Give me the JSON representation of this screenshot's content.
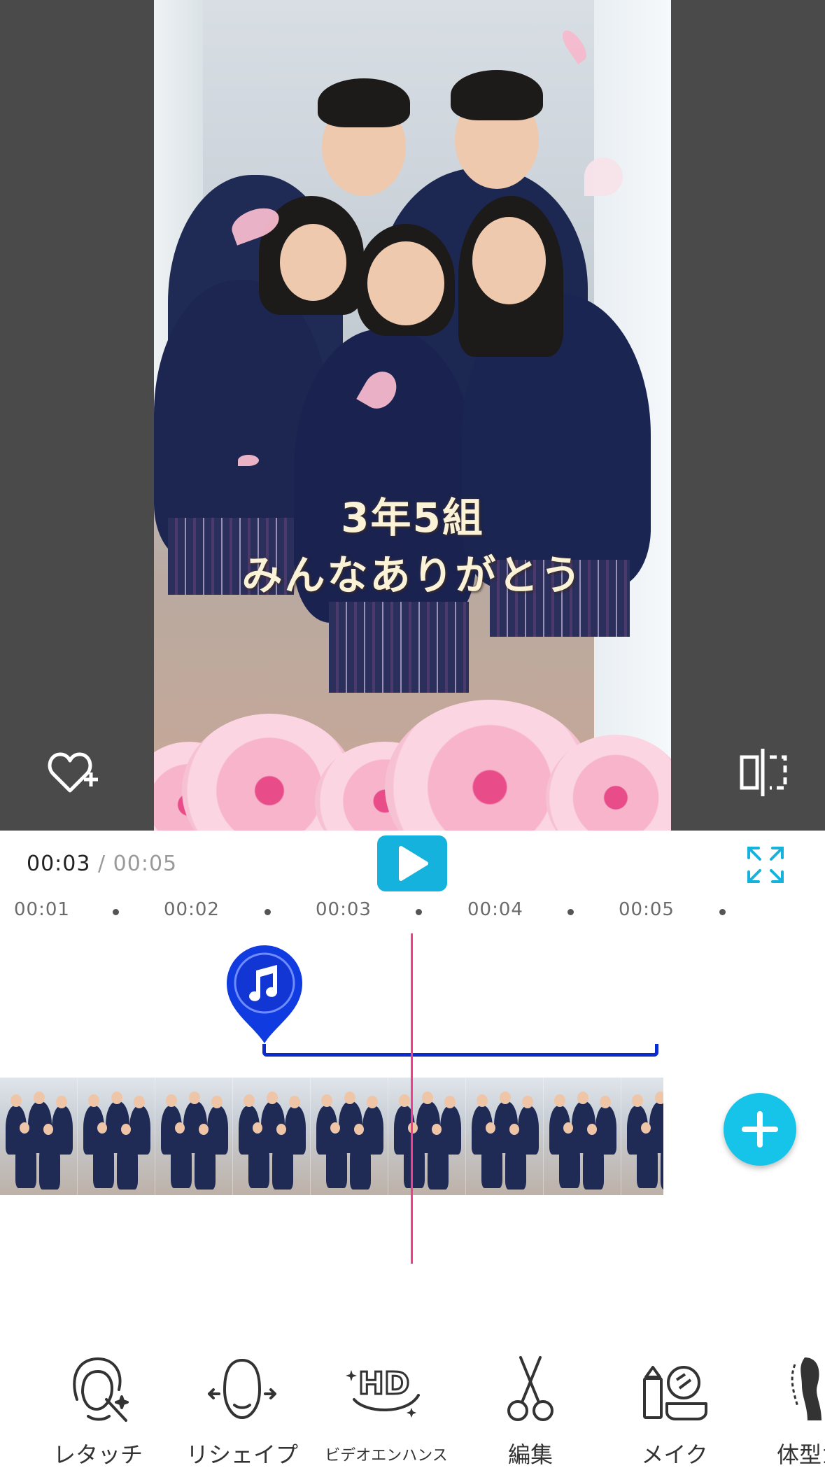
{
  "preview": {
    "caption_line1": "3年5組",
    "caption_line2": "みんなありがとう"
  },
  "playback": {
    "current_time": "00:03",
    "separator": "/",
    "total_time": "00:05"
  },
  "ruler": {
    "ticks": [
      "00:01",
      "00:02",
      "00:03",
      "00:04",
      "00:05"
    ]
  },
  "toolbar": {
    "items": [
      {
        "label": "レタッチ",
        "icon": "retouch-icon"
      },
      {
        "label": "リシェイプ",
        "icon": "reshape-icon"
      },
      {
        "label": "ビデオエンハンス",
        "icon": "hd-enhance-icon"
      },
      {
        "label": "編集",
        "icon": "scissors-icon"
      },
      {
        "label": "メイク",
        "icon": "makeup-icon"
      },
      {
        "label": "体型ガ",
        "icon": "body-shape-icon"
      }
    ]
  },
  "colors": {
    "accent": "#14b2dd",
    "playhead": "#ef3f8f",
    "music_track": "#0a2ccc"
  }
}
